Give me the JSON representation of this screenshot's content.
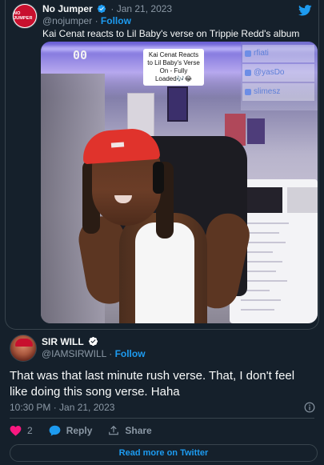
{
  "quoted_tweet": {
    "author_name": "No Jumper",
    "avatar_text": "NO JUMPER",
    "date": "· Jan 21, 2023",
    "handle": "@nojumper",
    "follow_label": "Follow",
    "text": "Kai Cenat reacts to Lil Baby's verse on Trippie Redd's album",
    "media": {
      "timer_text": "00",
      "caption": "Kai Cenat Reacts to Lil Baby's Verse On - Fully Loaded🎶😂",
      "tags": [
        "rfiati",
        "@yasDo",
        "slimesz"
      ]
    }
  },
  "main_tweet": {
    "author_name": "SIR WILL",
    "handle": "@IAMSIRWILL",
    "follow_label": "Follow",
    "text": "That was that last minute rush verse. That, I don't feel like doing this song verse. Haha",
    "timestamp": "10:30 PM · Jan 21, 2023",
    "likes": "2",
    "reply_label": "Reply",
    "share_label": "Share",
    "read_more_label": "Read more on Twitter"
  },
  "colors": {
    "background": "#15202b",
    "accent": "#1d9bf0",
    "like": "#f91880",
    "muted": "#8b98a5",
    "border": "#38444d"
  },
  "icons": [
    "verified-badge-icon",
    "twitter-bird-icon",
    "info-icon",
    "heart-icon",
    "reply-icon",
    "share-icon"
  ]
}
